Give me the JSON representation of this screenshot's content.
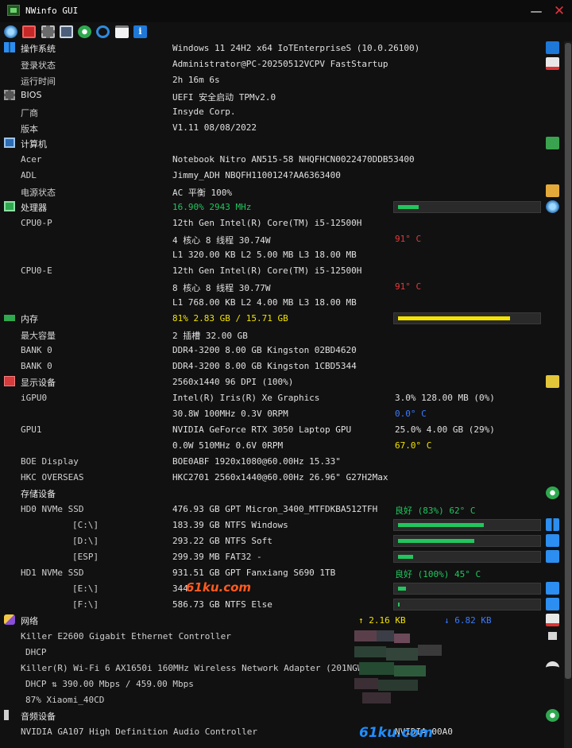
{
  "window": {
    "title": "NWinfo GUI"
  },
  "controls": {
    "minimize": "—",
    "close": "✕"
  },
  "toolbar": {
    "icons": [
      "cpu-fan-icon",
      "hwid-icon",
      "chip-icon",
      "pc-icon",
      "settings-icon",
      "refresh-icon",
      "clipboard-icon",
      "info-icon"
    ]
  },
  "rows": [
    {
      "label": "操作系统",
      "value": "Windows 11 24H2 x64 IoTEnterpriseS (10.0.26100)",
      "section": true,
      "icon": "windows-icon"
    },
    {
      "label": "登录状态",
      "value": "Administrator@PC-20250512VCPV FastStartup"
    },
    {
      "label": "运行时间",
      "value": "2h 16m 6s"
    },
    {
      "label": "BIOS",
      "value": "UEFI 安全启动 TPMv2.0",
      "section": true,
      "icon": "bios-chip-icon"
    },
    {
      "label": "厂商",
      "value": "Insyde Corp."
    },
    {
      "label": "版本",
      "value": "V1.11 08/08/2022"
    },
    {
      "label": "计算机",
      "value": "",
      "section": true,
      "icon": "computer-icon"
    },
    {
      "label": "Acer",
      "value": "Notebook Nitro AN515-58 NHQFHCN0022470DDB53400"
    },
    {
      "label": "ADL",
      "value": "Jimmy_ADH NBQFH1100124?AA6363400"
    },
    {
      "label": "电源状态",
      "value": "AC  平衡 100%"
    },
    {
      "label": "处理器",
      "value": "16.90% 2943 MHz",
      "section": true,
      "icon": "cpu-icon"
    },
    {
      "label": "CPU0-P",
      "value": "12th Gen Intel(R) Core(TM) i5-12500H"
    },
    {
      "label": "",
      "value": "4 核心 8 线程 30.74W",
      "value2": "91° C"
    },
    {
      "label": "",
      "value": "L1 320.00 KB L2 5.00 MB L3 18.00 MB"
    },
    {
      "label": "CPU0-E",
      "value": "12th Gen Intel(R) Core(TM) i5-12500H"
    },
    {
      "label": "",
      "value": "8 核心 8 线程 30.77W",
      "value2": "91° C"
    },
    {
      "label": "",
      "value": "L1 768.00 KB L2 4.00 MB L3 18.00 MB"
    },
    {
      "label": "内存",
      "value": "81% 2.83 GB / 15.71 GB",
      "section": true,
      "icon": "memory-icon"
    },
    {
      "label": "最大容量",
      "value": "2 插槽 32.00 GB"
    },
    {
      "label": "BANK 0",
      "value": "DDR4-3200 8.00 GB Kingston 02BD4620"
    },
    {
      "label": "BANK 0",
      "value": "DDR4-3200 8.00 GB Kingston 1CBD5344"
    },
    {
      "label": "显示设备",
      "value": "2560x1440 96 DPI (100%)",
      "section": true,
      "icon": "display-icon"
    },
    {
      "label": "iGPU0",
      "value": "Intel(R) Iris(R) Xe Graphics",
      "value2": "3.0%   128.00 MB (0%)"
    },
    {
      "label": "",
      "value": "30.8W 100MHz 0.3V 0RPM",
      "value2": "0.0° C"
    },
    {
      "label": "GPU1",
      "value": "NVIDIA GeForce RTX 3050 Laptop GPU",
      "value2": "25.0%  4.00 GB (29%)"
    },
    {
      "label": "",
      "value": "0.0W 510MHz 0.6V 0RPM",
      "value2": "67.0° C"
    },
    {
      "label": "BOE Display",
      "value": "BOE0ABF 1920x1080@60.00Hz 15.33\""
    },
    {
      "label": "HKC OVERSEAS",
      "value": "HKC2701 2560x1440@60.00Hz 26.96\" G27H2Max"
    },
    {
      "label": "存储设备",
      "value": "",
      "section": true,
      "icon": "storage-icon"
    },
    {
      "label": "HD0 NVMe SSD",
      "value": "476.93 GB GPT Micron_3400_MTFDKBA512TFH",
      "value2": "良好 (83%) 62° C"
    },
    {
      "label": "[C:\\]",
      "value": "183.39 GB NTFS Windows",
      "volume": true
    },
    {
      "label": "[D:\\]",
      "value": "293.22 GB NTFS Soft",
      "volume": true
    },
    {
      "label": "[ESP]",
      "value": "299.39 MB FAT32 -",
      "volume": true
    },
    {
      "label": "HD1 NVMe SSD",
      "value": "931.51 GB GPT Fanxiang S690 1TB",
      "value2": "良好 (100%) 45° C"
    },
    {
      "label": "[E:\\]",
      "value": "344.",
      "volume": true
    },
    {
      "label": "[F:\\]",
      "value": "586.73 GB NTFS Else",
      "volume": true
    },
    {
      "label": "网络",
      "value": "",
      "section": true,
      "icon": "network-icon",
      "up": "↑ 2.16 KB",
      "down": "↓ 6.82 KB"
    },
    {
      "label": "Killer E2600 Gigabit Ethernet Controller",
      "value": "",
      "wide": true
    },
    {
      "label": "DHCP",
      "value": "",
      "indent": true
    },
    {
      "label": "Killer(R) Wi-Fi 6 AX1650i 160MHz Wireless Network Adapter (201NGW)",
      "value": "",
      "wide": true
    },
    {
      "label": "DHCP ⇅ 390.00 Mbps / 459.00 Mbps",
      "value": "",
      "wide": true,
      "indent": true
    },
    {
      "label": "87% Xiaomi_40CD",
      "value": "",
      "wide": true,
      "indent": true
    },
    {
      "label": "音频设备",
      "value": "",
      "section": true,
      "icon": "audio-icon"
    },
    {
      "label": "NVIDIA GA107 High Definition Audio Controller",
      "value": "",
      "wide": true,
      "value2": "NVIDIA 00A0"
    }
  ],
  "bars": [
    {
      "row": 10,
      "fraction": 0.15,
      "color": "#22c55e"
    },
    {
      "row": 17,
      "fraction": 0.81,
      "color": "#f2e300"
    },
    {
      "row": 30,
      "fraction": 0.62,
      "color": "#22c55e"
    },
    {
      "row": 31,
      "fraction": 0.55,
      "color": "#22c55e"
    },
    {
      "row": 32,
      "fraction": 0.11,
      "color": "#22c55e"
    },
    {
      "row": 34,
      "fraction": 0.06,
      "color": "#22c55e"
    },
    {
      "row": 35,
      "fraction": 0.01,
      "color": "#22c55e"
    }
  ],
  "colors": {
    "ok": "#22c55e",
    "hot": "#e23b3b",
    "warm": "#f2e300",
    "cool": "#3a7bff",
    "up": "#f2e300",
    "down": "#3a7bff"
  },
  "watermark": {
    "text": "61ku.com"
  }
}
